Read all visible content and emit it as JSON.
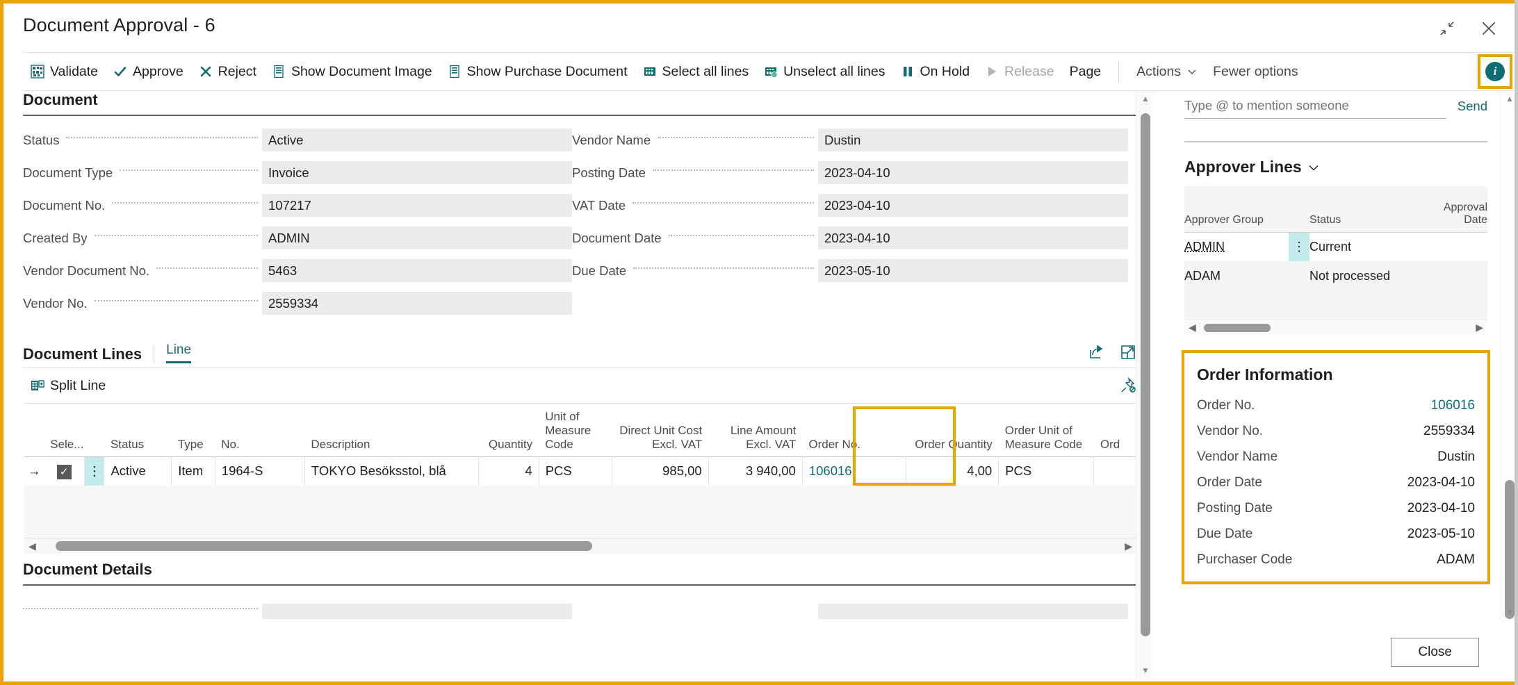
{
  "window": {
    "title": "Document Approval - 6",
    "restore_icon": "restore-down-icon",
    "close_icon": "close-icon"
  },
  "toolbar": {
    "items": [
      {
        "label": "Validate",
        "icon": "validate-icon",
        "disabled": false
      },
      {
        "label": "Approve",
        "icon": "check-icon",
        "disabled": false
      },
      {
        "label": "Reject",
        "icon": "cross-icon",
        "disabled": false
      },
      {
        "label": "Show Document Image",
        "icon": "document-image-icon",
        "disabled": false
      },
      {
        "label": "Show Purchase Document",
        "icon": "purchase-document-icon",
        "disabled": false
      },
      {
        "label": "Select all lines",
        "icon": "select-all-lines-icon",
        "disabled": false
      },
      {
        "label": "Unselect all lines",
        "icon": "unselect-all-lines-icon",
        "disabled": false
      },
      {
        "label": "On Hold",
        "icon": "pause-icon",
        "disabled": false
      },
      {
        "label": "Release",
        "icon": "play-icon",
        "disabled": true
      },
      {
        "label": "Page",
        "icon": "",
        "disabled": false
      }
    ],
    "actions_label": "Actions",
    "fewer_options_label": "Fewer options",
    "info_button": "info-icon"
  },
  "document_section": {
    "heading": "Document",
    "left_fields": [
      {
        "label": "Status",
        "value": "Active"
      },
      {
        "label": "Document Type",
        "value": "Invoice"
      },
      {
        "label": "Document No.",
        "value": "107217"
      },
      {
        "label": "Created By",
        "value": "ADMIN"
      },
      {
        "label": "Vendor Document No.",
        "value": "5463"
      },
      {
        "label": "Vendor No.",
        "value": "2559334"
      }
    ],
    "right_fields": [
      {
        "label": "Vendor Name",
        "value": "Dustin"
      },
      {
        "label": "Posting Date",
        "value": "2023-04-10"
      },
      {
        "label": "VAT Date",
        "value": "2023-04-10"
      },
      {
        "label": "Document Date",
        "value": "2023-04-10"
      },
      {
        "label": "Due Date",
        "value": "2023-05-10"
      }
    ]
  },
  "document_lines": {
    "heading": "Document Lines",
    "tab_label": "Line",
    "share_icon": "share-icon",
    "open_in_new_icon": "open-in-new-window-icon",
    "pin_icon": "unpin-icon",
    "subcommand": {
      "label": "Split Line",
      "icon": "split-line-icon"
    },
    "columns": [
      {
        "label": "Sele...",
        "align": "left"
      },
      {
        "label": "Status",
        "align": "left"
      },
      {
        "label": "Type",
        "align": "left"
      },
      {
        "label": "No.",
        "align": "left"
      },
      {
        "label": "Description",
        "align": "left"
      },
      {
        "label": "Quantity",
        "align": "right"
      },
      {
        "label": "Unit of Measure Code",
        "align": "left"
      },
      {
        "label": "Direct Unit Cost Excl. VAT",
        "align": "right"
      },
      {
        "label": "Line Amount Excl. VAT",
        "align": "right"
      },
      {
        "label": "Order No.",
        "align": "left"
      },
      {
        "label": "Order Quantity",
        "align": "right"
      },
      {
        "label": "Order Unit of Measure Code",
        "align": "left"
      },
      {
        "label": "Ord",
        "align": "left"
      }
    ],
    "rows": [
      {
        "selected": true,
        "status": "Active",
        "type": "Item",
        "no": "1964-S",
        "description": "TOKYO Besöksstol, blå",
        "quantity": "4",
        "uom": "PCS",
        "direct_unit_cost": "985,00",
        "line_amount": "3 940,00",
        "order_no": "106016",
        "order_quantity": "4,00",
        "order_uom": "PCS",
        "ord": ""
      }
    ]
  },
  "document_details": {
    "heading": "Document Details"
  },
  "factbox": {
    "mention_placeholder": "Type @ to mention someone",
    "mention_value": "",
    "send_label": "Send",
    "approver_lines": {
      "title": "Approver Lines",
      "chevron": "chevron-down-icon",
      "columns": [
        "Approver Group",
        "Status",
        "Approval Date"
      ],
      "rows": [
        {
          "group": "ADMIN",
          "status": "Current",
          "approval_date": "",
          "current": true
        },
        {
          "group": "ADAM",
          "status": "Not processed",
          "approval_date": "",
          "current": false
        }
      ]
    },
    "order_information": {
      "title": "Order Information",
      "rows": [
        {
          "label": "Order No.",
          "value": "106016",
          "link": true
        },
        {
          "label": "Vendor No.",
          "value": "2559334",
          "link": false
        },
        {
          "label": "Vendor Name",
          "value": "Dustin",
          "link": false
        },
        {
          "label": "Order Date",
          "value": "2023-04-10",
          "link": false
        },
        {
          "label": "Posting Date",
          "value": "2023-04-10",
          "link": false
        },
        {
          "label": "Due Date",
          "value": "2023-05-10",
          "link": false
        },
        {
          "label": "Purchaser Code",
          "value": "ADAM",
          "link": false
        }
      ]
    }
  },
  "footer": {
    "close_label": "Close"
  },
  "colors": {
    "accent_teal": "#0f6c74",
    "highlight_orange": "#eaa300",
    "field_bg": "#ebebeb",
    "row_indicator": "#c3ebeb"
  }
}
